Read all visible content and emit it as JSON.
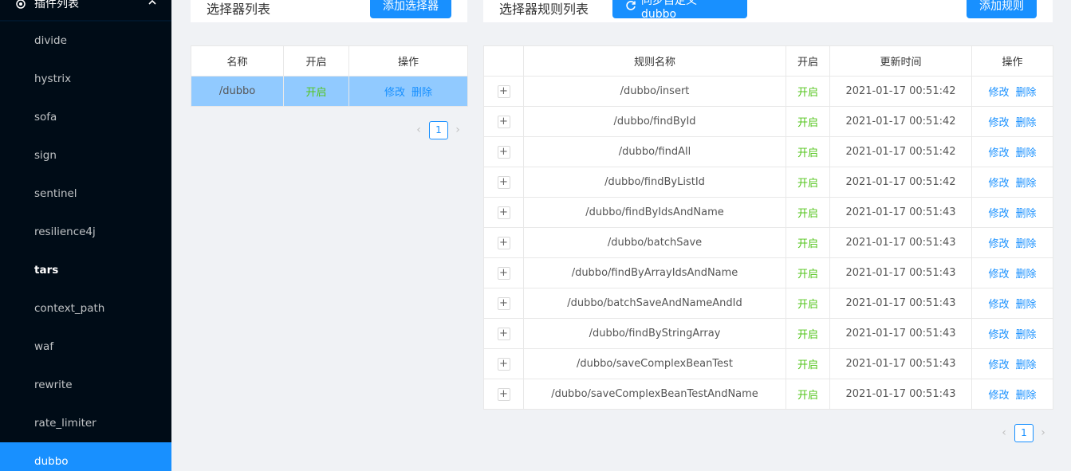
{
  "sidebar": {
    "submenu_title": "插件列表",
    "items": [
      {
        "label": "divide"
      },
      {
        "label": "hystrix"
      },
      {
        "label": "sofa"
      },
      {
        "label": "sign"
      },
      {
        "label": "sentinel"
      },
      {
        "label": "resilience4j"
      },
      {
        "label": "tars"
      },
      {
        "label": "context_path"
      },
      {
        "label": "waf"
      },
      {
        "label": "rewrite"
      },
      {
        "label": "rate_limiter"
      },
      {
        "label": "dubbo"
      }
    ]
  },
  "selector_panel": {
    "title": "选择器列表",
    "add_button": "添加选择器",
    "headers": [
      "名称",
      "开启",
      "操作"
    ],
    "rows": [
      {
        "name": "/dubbo",
        "status": "开启",
        "edit": "修改",
        "delete": "删除"
      }
    ],
    "page": "1"
  },
  "rule_panel": {
    "title": "选择器规则列表",
    "sync_button": "同步自定义 dubbo",
    "add_button": "添加规则",
    "headers": [
      "",
      "规则名称",
      "开启",
      "更新时间",
      "操作"
    ],
    "rows": [
      {
        "expand": "+",
        "name": "/dubbo/insert",
        "status": "开启",
        "time": "2021-01-17 00:51:42",
        "edit": "修改",
        "delete": "删除"
      },
      {
        "expand": "+",
        "name": "/dubbo/findById",
        "status": "开启",
        "time": "2021-01-17 00:51:42",
        "edit": "修改",
        "delete": "删除"
      },
      {
        "expand": "+",
        "name": "/dubbo/findAll",
        "status": "开启",
        "time": "2021-01-17 00:51:42",
        "edit": "修改",
        "delete": "删除"
      },
      {
        "expand": "+",
        "name": "/dubbo/findByListId",
        "status": "开启",
        "time": "2021-01-17 00:51:42",
        "edit": "修改",
        "delete": "删除"
      },
      {
        "expand": "+",
        "name": "/dubbo/findByIdsAndName",
        "status": "开启",
        "time": "2021-01-17 00:51:43",
        "edit": "修改",
        "delete": "删除"
      },
      {
        "expand": "+",
        "name": "/dubbo/batchSave",
        "status": "开启",
        "time": "2021-01-17 00:51:43",
        "edit": "修改",
        "delete": "删除"
      },
      {
        "expand": "+",
        "name": "/dubbo/findByArrayIdsAndName",
        "status": "开启",
        "time": "2021-01-17 00:51:43",
        "edit": "修改",
        "delete": "删除"
      },
      {
        "expand": "+",
        "name": "/dubbo/batchSaveAndNameAndId",
        "status": "开启",
        "time": "2021-01-17 00:51:43",
        "edit": "修改",
        "delete": "删除"
      },
      {
        "expand": "+",
        "name": "/dubbo/findByStringArray",
        "status": "开启",
        "time": "2021-01-17 00:51:43",
        "edit": "修改",
        "delete": "删除"
      },
      {
        "expand": "+",
        "name": "/dubbo/saveComplexBeanTest",
        "status": "开启",
        "time": "2021-01-17 00:51:43",
        "edit": "修改",
        "delete": "删除"
      },
      {
        "expand": "+",
        "name": "/dubbo/saveComplexBeanTestAndName",
        "status": "开启",
        "time": "2021-01-17 00:51:43",
        "edit": "修改",
        "delete": "删除"
      }
    ],
    "page": "1"
  },
  "icons": {
    "submenu": "setting-icon",
    "collapse": "chevron-up-icon",
    "sync": "sync-icon",
    "prev": "chevron-left-icon",
    "next": "chevron-right-icon"
  },
  "colors": {
    "sidebar_bg": "#001529",
    "submenu_bg": "#000c17",
    "primary": "#1890ff",
    "status_on": "#52c41a",
    "selected_row": "#91caff",
    "page_bg": "#f0f2f5"
  }
}
